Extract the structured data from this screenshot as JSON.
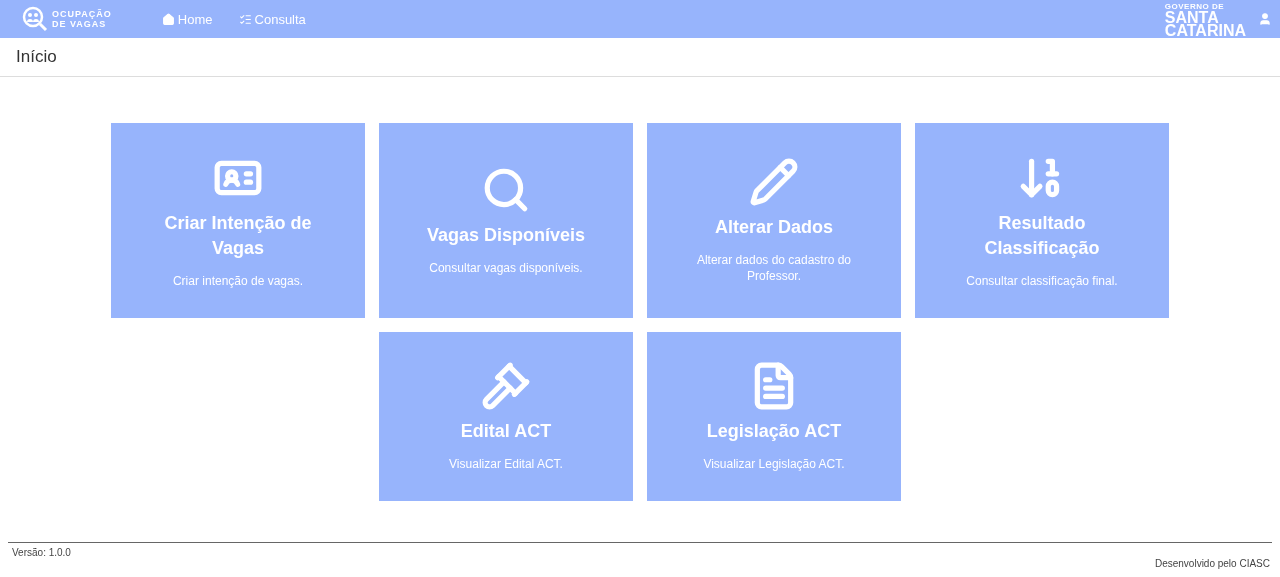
{
  "header": {
    "logo_lines": [
      "OCUPAÇÃO",
      "DE VAGAS"
    ],
    "nav": [
      {
        "label": "Home"
      },
      {
        "label": "Consulta"
      }
    ],
    "gov_logo": [
      "GOVERNO DE",
      "SANTA",
      "CATARINA"
    ]
  },
  "breadcrumb": "Início",
  "card_rows": [
    [
      {
        "title": "Criar Intenção de Vagas",
        "description": "Criar intenção de vagas."
      },
      {
        "title": "Vagas Disponíveis",
        "description": "Consultar vagas disponíveis."
      },
      {
        "title": "Alterar Dados",
        "description": "Alterar dados do cadastro do Professor."
      },
      {
        "title": "Resultado Classificação",
        "description": "Consultar classificação final."
      }
    ],
    [
      {
        "title": "Edital ACT",
        "description": "Visualizar Edital ACT."
      },
      {
        "title": "Legislação ACT",
        "description": "Visualizar Legislação ACT."
      }
    ]
  ],
  "footer": {
    "version": "Versão: 1.0.0",
    "credit": "Desenvolvido pelo CIASC"
  }
}
